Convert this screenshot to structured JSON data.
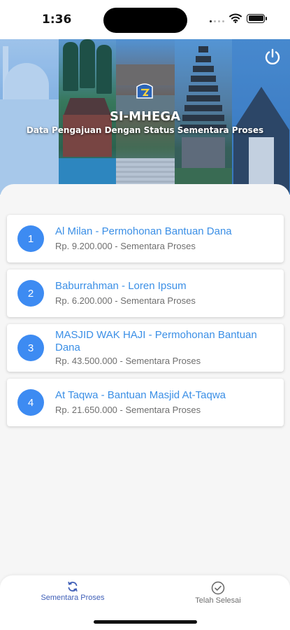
{
  "status_bar": {
    "time": "1:36"
  },
  "header": {
    "title": "SI-MHEGA",
    "subtitle": "Data Pengajuan Dengan Status Sementara Proses",
    "logout_icon": "power-icon"
  },
  "submissions": [
    {
      "number": "1",
      "title": "Al Milan - Permohonan Bantuan Dana",
      "subtitle": "Rp. 9.200.000 - Sementara Proses"
    },
    {
      "number": "2",
      "title": "Baburrahman - Loren Ipsum",
      "subtitle": "Rp. 6.200.000 - Sementara Proses"
    },
    {
      "number": "3",
      "title": "MASJID WAK HAJI - Permohonan Bantuan Dana",
      "subtitle": "Rp. 43.500.000 - Sementara Proses"
    },
    {
      "number": "4",
      "title": "At Taqwa - Bantuan Masjid At-Taqwa",
      "subtitle": "Rp. 21.650.000 - Sementara Proses"
    }
  ],
  "bottom_nav": {
    "items": [
      {
        "label": "Sementara Proses",
        "icon": "refresh-icon",
        "active": true
      },
      {
        "label": "Telah Selesai",
        "icon": "check-circle-icon",
        "active": false
      }
    ]
  },
  "colors": {
    "accent": "#3b8fe6",
    "avatar": "#3d8bf2",
    "nav_active": "#3f5fb7"
  }
}
